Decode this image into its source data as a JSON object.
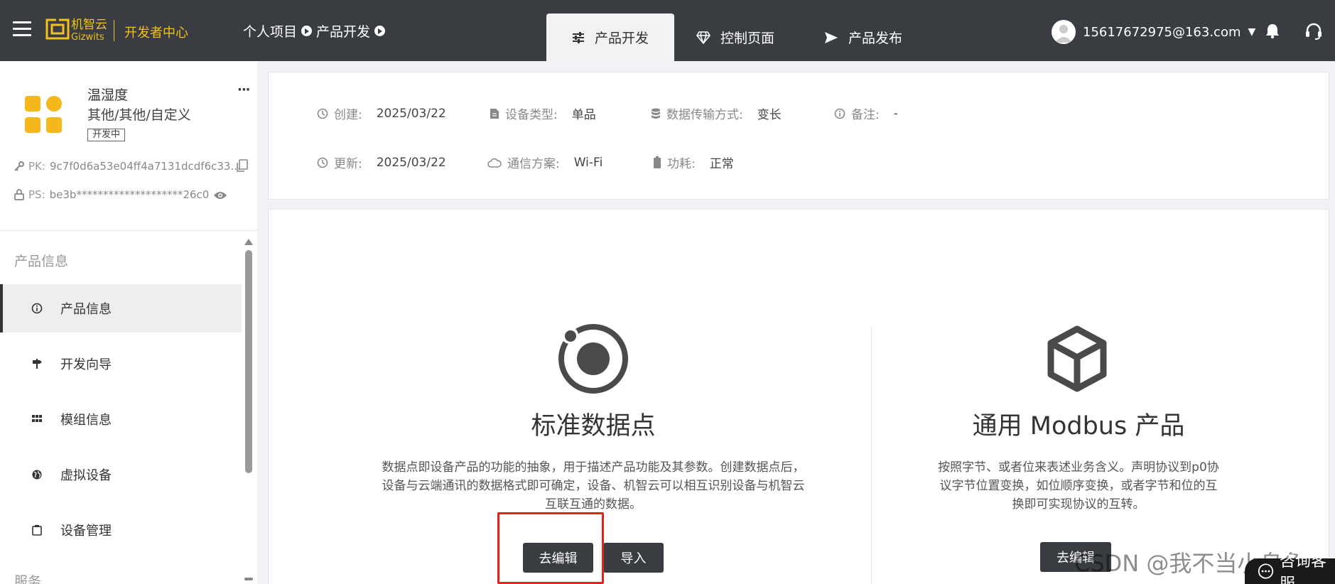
{
  "header": {
    "logo_cn": "机智云",
    "logo_en": "Gizwits",
    "dev_center": "开发者中心",
    "breadcrumb": [
      "个人项目",
      "产品开发"
    ],
    "tabs": [
      {
        "label": "产品开发",
        "icon": "sliders-icon",
        "active": true
      },
      {
        "label": "控制页面",
        "icon": "diamond-icon",
        "active": false
      },
      {
        "label": "产品发布",
        "icon": "send-icon",
        "active": false
      }
    ],
    "user_email": "15617672975@163.com"
  },
  "product": {
    "name": "温湿度",
    "category": "其他/其他/自定义",
    "status": "开发中",
    "pk_label": "PK:",
    "pk_value": "9c7f0d6a53e04ff4a7131dcdf6c33...",
    "ps_label": "PS:",
    "ps_value": "be3b********************26c0"
  },
  "sidebar": {
    "section_title": "产品信息",
    "items": [
      {
        "label": "产品信息",
        "icon": "info-icon",
        "active": true
      },
      {
        "label": "开发向导",
        "icon": "signpost-icon",
        "active": false
      },
      {
        "label": "模组信息",
        "icon": "grid-icon",
        "active": false
      },
      {
        "label": "虚拟设备",
        "icon": "globe-icon",
        "active": false
      },
      {
        "label": "设备管理",
        "icon": "clipboard-icon",
        "active": false
      }
    ],
    "bottom_section": "服务"
  },
  "info": {
    "created_label": "创建:",
    "created_value": "2025/03/22",
    "device_type_label": "设备类型:",
    "device_type_value": "单品",
    "transfer_label": "数据传输方式:",
    "transfer_value": "变长",
    "remark_label": "备注:",
    "remark_value": "-",
    "updated_label": "更新:",
    "updated_value": "2025/03/22",
    "comm_label": "通信方案:",
    "comm_value": "Wi-Fi",
    "power_label": "功耗:",
    "power_value": "正常"
  },
  "options": {
    "standard": {
      "title": "标准数据点",
      "desc_lines": [
        "数据点即设备产品的功能的抽象，用于描述产品功能及其参数。创建数据点后，",
        "设备与云端通讯的数据格式即可确定，设备、机智云可以相互识别设备与机智云",
        "互联互通的数据。"
      ],
      "edit_button": "去编辑",
      "import_button": "导入"
    },
    "modbus": {
      "title": "通用 Modbus 产品",
      "desc_lines": [
        "按照字节、或者位来表述业务含义。声明协议到p0协",
        "议字节位置变换，如位顺序变换，或者字节和位的互",
        "换即可实现协议的互转。"
      ],
      "edit_button": "去编辑"
    }
  },
  "watermark": "CSDN @我不当小乌龟",
  "consult_label": "咨询客服",
  "colors": {
    "topbar": "#393c40",
    "logo": "#f3c11b",
    "product_icon": "#f5b81c",
    "highlight": "#e8201b"
  }
}
